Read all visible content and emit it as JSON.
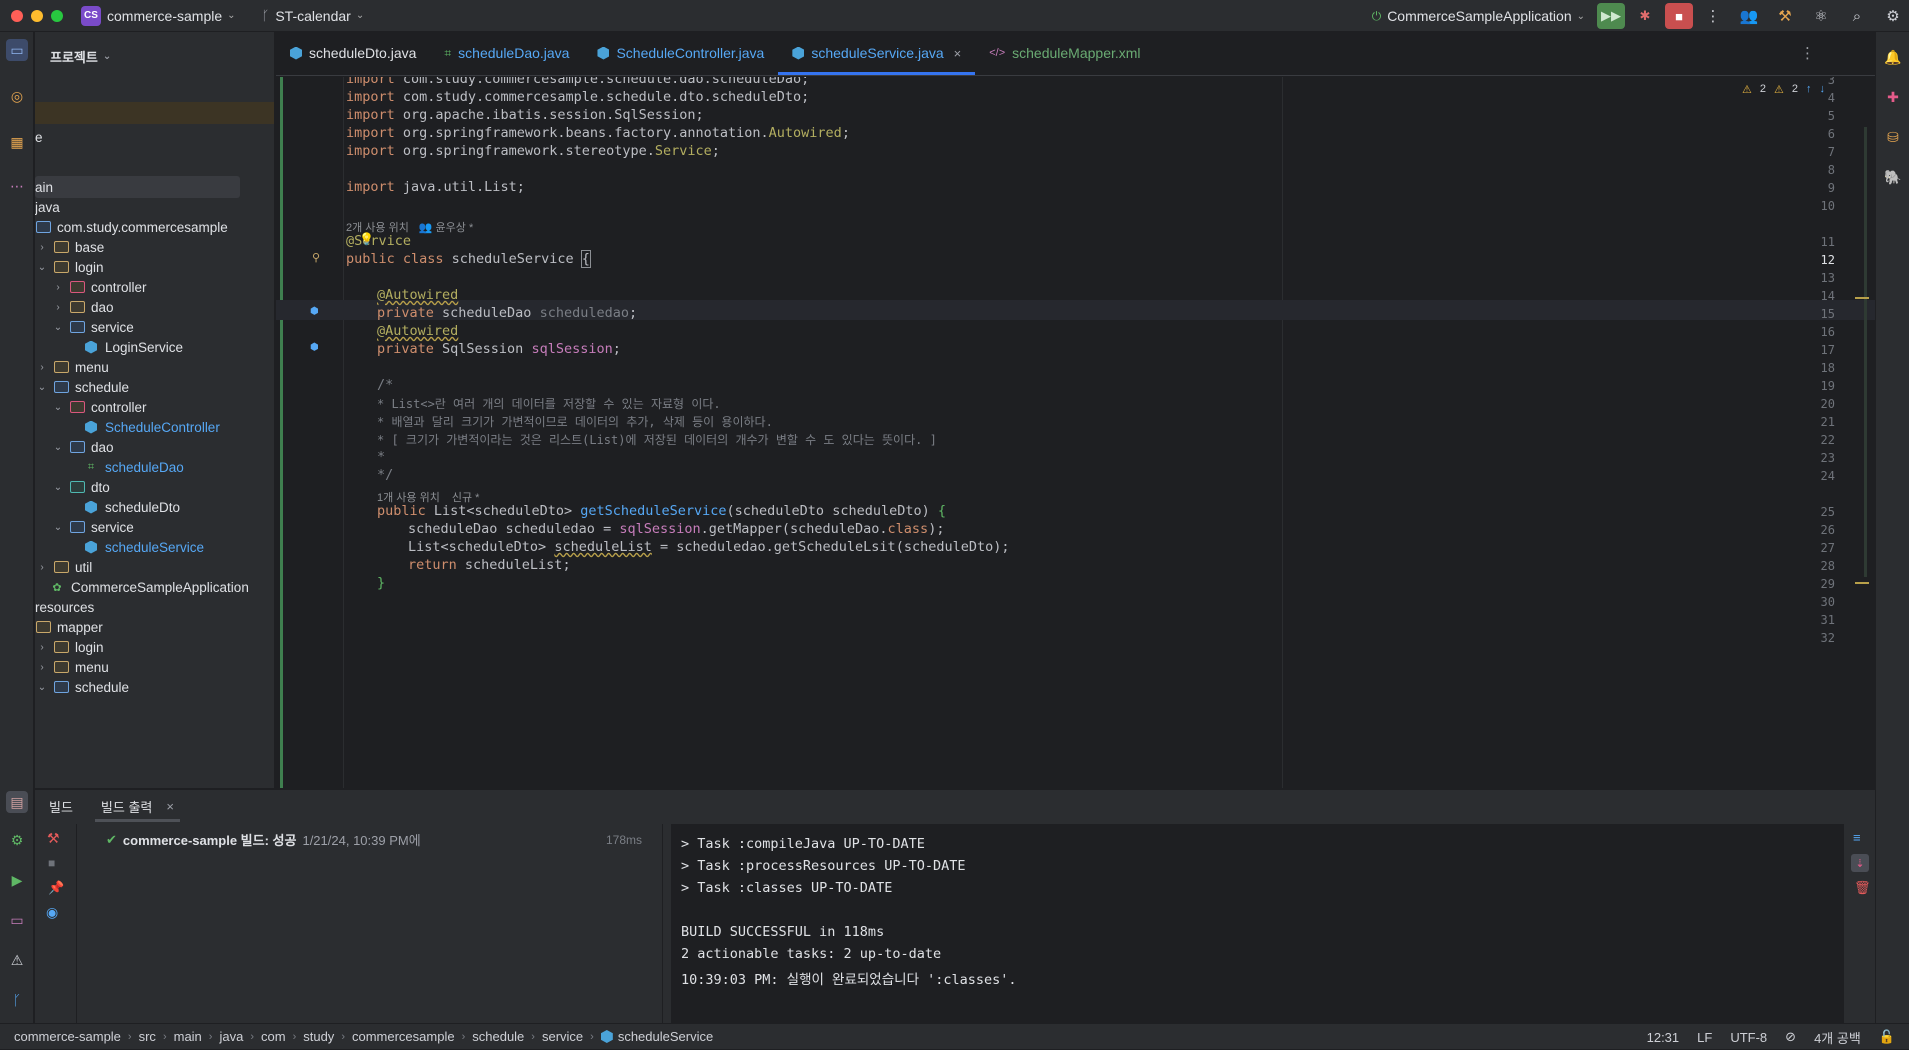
{
  "titlebar": {
    "project_badge": "CS",
    "project_name": "commerce-sample",
    "branch": "ST-calendar",
    "run_config": "CommerceSampleApplication"
  },
  "project_panel": {
    "title": "프로젝트",
    "rows": [
      {
        "label": "e"
      },
      {
        "label": "ain"
      },
      {
        "label": "java"
      },
      {
        "label": "com.study.commercesample"
      },
      {
        "label": "base"
      },
      {
        "label": "login"
      },
      {
        "label": "controller"
      },
      {
        "label": "dao"
      },
      {
        "label": "service"
      },
      {
        "label": "LoginService"
      },
      {
        "label": "menu"
      },
      {
        "label": "schedule"
      },
      {
        "label": "controller"
      },
      {
        "label": "ScheduleController"
      },
      {
        "label": "dao"
      },
      {
        "label": "scheduleDao"
      },
      {
        "label": "dto"
      },
      {
        "label": "scheduleDto"
      },
      {
        "label": "service"
      },
      {
        "label": "scheduleService"
      },
      {
        "label": "util"
      },
      {
        "label": "CommerceSampleApplication"
      },
      {
        "label": "resources"
      },
      {
        "label": "mapper"
      },
      {
        "label": "login"
      },
      {
        "label": "menu"
      },
      {
        "label": "schedule"
      }
    ]
  },
  "tabs": [
    {
      "label": "scheduleDto.java"
    },
    {
      "label": "scheduleDao.java"
    },
    {
      "label": "ScheduleController.java"
    },
    {
      "label": "scheduleService.java"
    },
    {
      "label": "scheduleMapper.xml"
    }
  ],
  "editor": {
    "warnings_a": "2",
    "warnings_b": "2",
    "line_numbers": [
      "3",
      "4",
      "5",
      "6",
      "7",
      "8",
      "9",
      "10",
      "11",
      "12",
      "13",
      "14",
      "15",
      "16",
      "17",
      "18",
      "19",
      "20",
      "21",
      "22",
      "23",
      "24",
      "25",
      "26",
      "27",
      "28",
      "29",
      "30",
      "31",
      "32"
    ],
    "lines": {
      "l3": [
        "import ",
        "com.study.commercesample.schedule.dao.scheduleDao;"
      ],
      "l4": [
        "import ",
        "com.study.commercesample.schedule.dto.scheduleDto;"
      ],
      "l5": [
        "import ",
        "org.apache.ibatis.session.SqlSession;"
      ],
      "l6": [
        "import ",
        "org.springframework.beans.factory.annotation.",
        "Autowired",
        ";"
      ],
      "l7": [
        "import ",
        "org.springframework.stereotype.",
        "Service",
        ";"
      ],
      "l9": [
        "import ",
        "java.util.List;"
      ],
      "hint1a": "2개 사용 위치",
      "hint1b": "윤우상 *",
      "l11": [
        "@Service"
      ],
      "l12": [
        "public class ",
        "scheduleService ",
        "{"
      ],
      "l14": [
        "@Autowired"
      ],
      "l15": [
        "private ",
        "scheduleDao ",
        "scheduledao",
        ";"
      ],
      "l16": [
        "@Autowired"
      ],
      "l17": [
        "private ",
        "SqlSession ",
        "sqlSession",
        ";"
      ],
      "l19": "/*",
      "l20": "* List<>란 여러 개의 데이터를 저장할 수 있는 자료형 이다.",
      "l21": "* 배열과 달리 크기가 가변적이므로 데이터의 추가, 삭제 등이 용이하다.",
      "l22": "* [ 크기가 가변적이라는 것은 리스트(List)에 저장된 데이터의 개수가 변할 수 도 있다는 뜻이다. ]",
      "l23": "*",
      "l24": "*/",
      "hint2a": "1개 사용 위치",
      "hint2b": "신규 *",
      "l25": [
        "public ",
        "List<scheduleDto> ",
        "getScheduleService",
        "(scheduleDto scheduleDto) ",
        "{"
      ],
      "l26": [
        "scheduleDao scheduledao = ",
        "sqlSession",
        ".getMapper(scheduleDao.",
        "class",
        ");"
      ],
      "l27": [
        "List<scheduleDto> ",
        "scheduleList",
        " = scheduledao.getScheduleLsit(scheduleDto);"
      ],
      "l28": [
        "return ",
        "scheduleList;"
      ],
      "l29": "}"
    }
  },
  "build_panel": {
    "tab_build": "빌드",
    "tab_output": "빌드 출력",
    "result_title": "commerce-sample 빌드: 성공",
    "result_time": "1/21/24, 10:39 PM에",
    "duration": "178ms",
    "console": [
      "> Task :compileJava UP-TO-DATE",
      "> Task :processResources UP-TO-DATE",
      "> Task :classes UP-TO-DATE",
      "",
      "BUILD SUCCESSFUL in 118ms",
      "2 actionable tasks: 2 up-to-date",
      "10:39:03 PM: 실행이 완료되었습니다 ':classes'."
    ]
  },
  "statusbar": {
    "crumbs": [
      "commerce-sample",
      "src",
      "main",
      "java",
      "com",
      "study",
      "commercesample",
      "schedule",
      "service",
      "scheduleService"
    ],
    "position": "12:31",
    "line_sep": "LF",
    "encoding": "UTF-8",
    "indent": "4개 공백"
  },
  "colors": {
    "accent": "#3574f0",
    "bg_editor": "#1e1f22",
    "bg_panel": "#2b2d30"
  }
}
